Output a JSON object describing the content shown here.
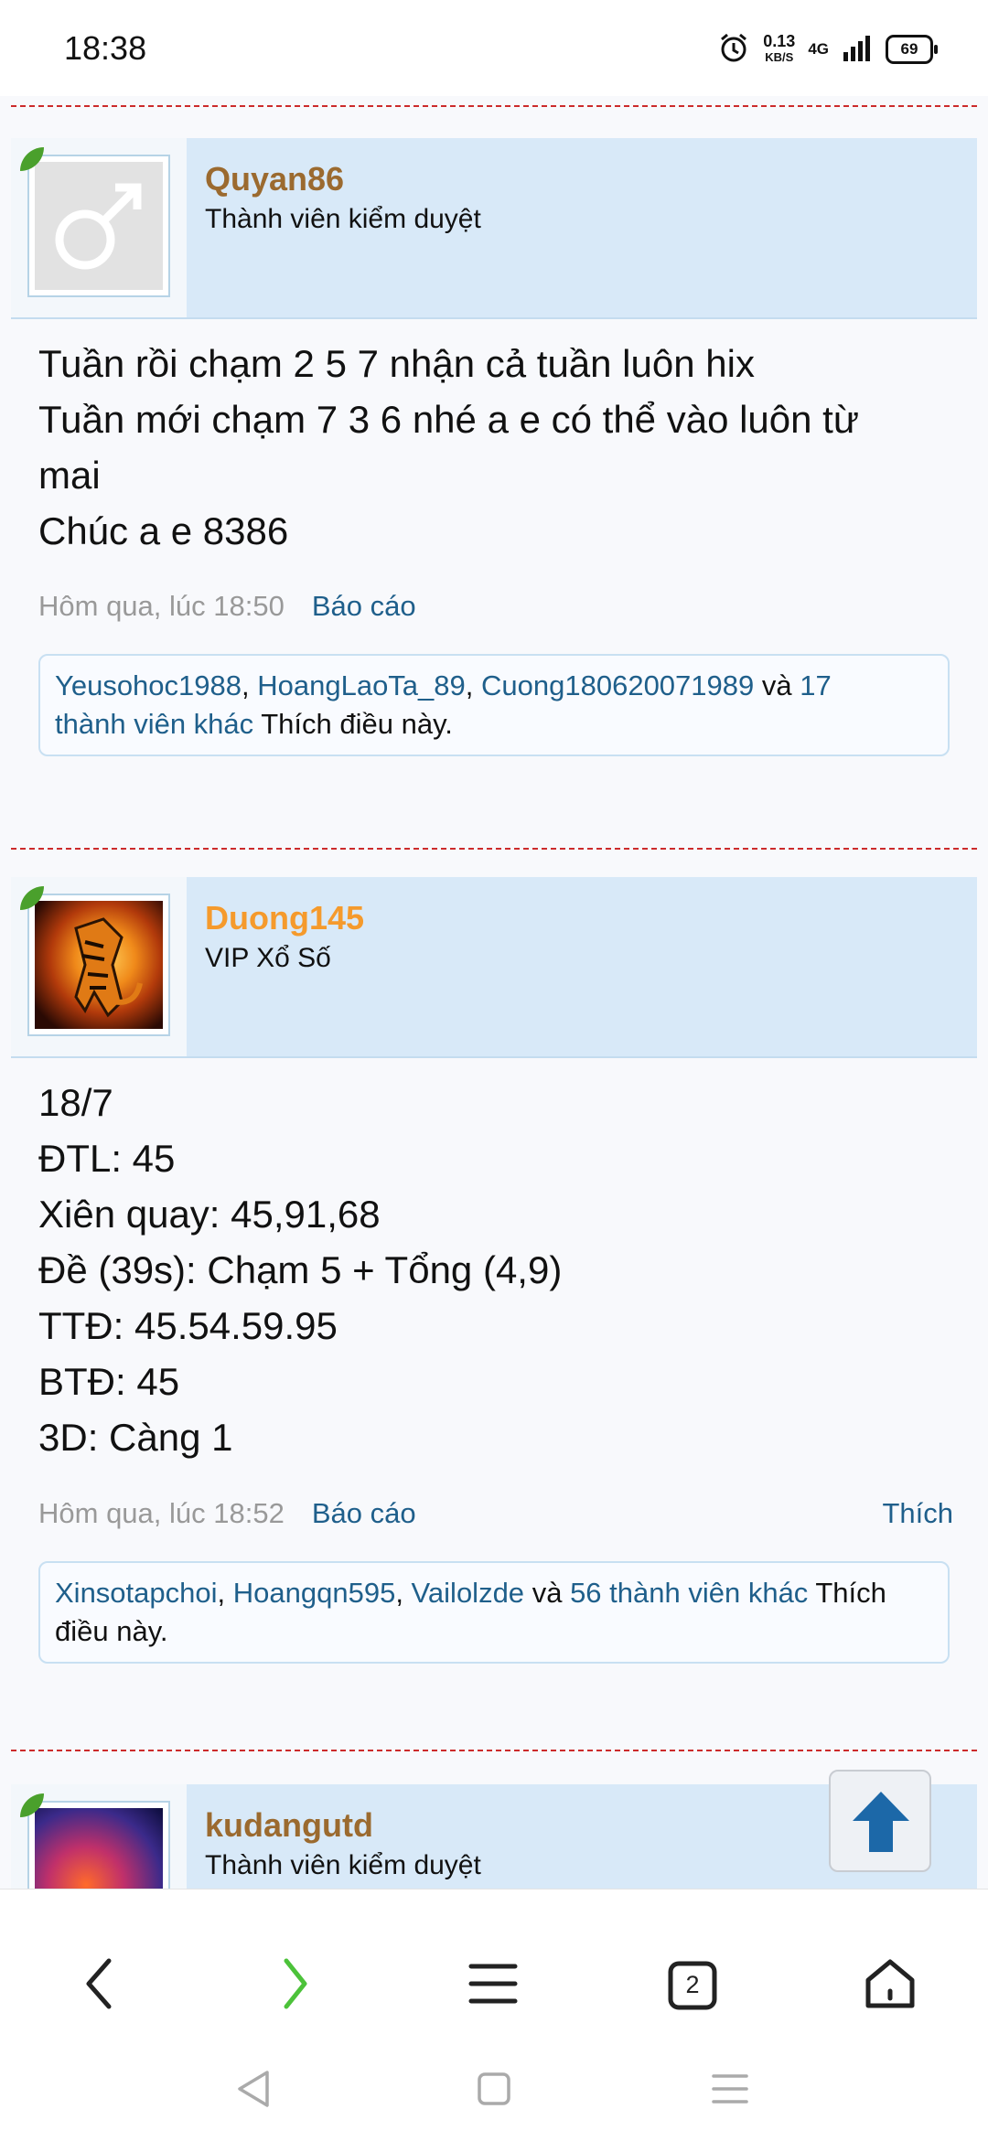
{
  "status_bar": {
    "time": "18:38",
    "speed_value": "0.13",
    "speed_unit": "KB/S",
    "network": "4G",
    "battery": "69"
  },
  "posts": [
    {
      "username": "Quyan86",
      "username_color": "#9b6a2f",
      "user_title": "Thành viên kiểm duyệt",
      "body": [
        "Tuần rồi chạm 2 5 7 nhận cả tuần luôn hix",
        "Tuần mới chạm 7 3 6 nhé a e có thể vào luôn từ",
        "mai",
        "Chúc a e 8386"
      ],
      "time": "Hôm qua, lúc 18:50",
      "report": "Báo cáo",
      "likers": [
        "Yeusohoc1988",
        "HoangLaoTa_89",
        "Cuong180620071989"
      ],
      "likes_and": "và",
      "likes_others": "17",
      "likes_others_suffix": "thành viên khác",
      "likes_suffix": "Thích điều này."
    },
    {
      "username": "Duong145",
      "username_color": "#f59a2c",
      "user_title": "VIP Xổ Số",
      "body": [
        "18/7",
        "ĐTL: 45",
        "Xiên quay: 45,91,68",
        "Đề (39s): Chạm 5 + Tổng (4,9)",
        "TTĐ: 45.54.59.95",
        "BTĐ: 45",
        "3D: Càng 1"
      ],
      "time": "Hôm qua, lúc 18:52",
      "report": "Báo cáo",
      "like": "Thích",
      "likers": [
        "Xinsotapchoi",
        "Hoangqn595",
        "Vailolzde"
      ],
      "likes_and": "và",
      "likes_others": "56 thành viên khác",
      "likes_suffix_line1": "Thích",
      "likes_suffix_line2": "điều này."
    },
    {
      "username": "kudangutd",
      "username_color": "#9b6a2f",
      "user_title": "Thành viên kiểm duyệt"
    }
  ],
  "browser_nav": {
    "tab_count": "2"
  }
}
